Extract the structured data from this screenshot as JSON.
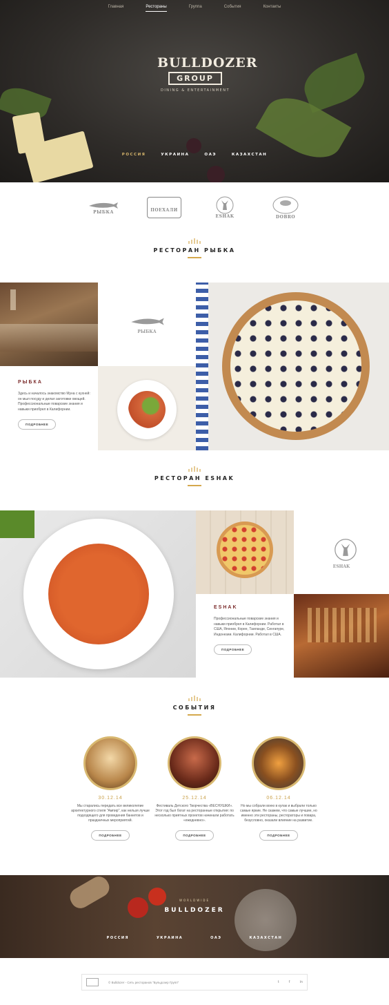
{
  "nav": [
    "Главная",
    "Рестораны",
    "Группа",
    "События",
    "Контакты"
  ],
  "nav_active": 1,
  "logo": {
    "brand": "BULLDOZER",
    "group": "GROUP",
    "tagline": "DINING & ENTERTAINMENT"
  },
  "countries": [
    "РОССИЯ",
    "УКРАИНА",
    "ОАЭ",
    "КАЗАХСТАН"
  ],
  "partners": [
    "РЫБКА",
    "ПОЕХАЛИ",
    "ESHAK",
    "DOBRO"
  ],
  "section1": {
    "title": "РЕСТОРАН РЫБКА"
  },
  "rybka": {
    "heading": "РЫБКА",
    "text": "Здесь и началось знакомство Муна с кухней: он мыл посуду и делал заготовки овощей. Профессиональные поварские знания и навыки приобрел в Калифорнии.",
    "button": "ПОДРОБНЕЕ",
    "logo": "РЫБКА"
  },
  "section2": {
    "title": "РЕСТОРАН ESHAK"
  },
  "eshak": {
    "heading": "ESHAK",
    "text": "Профессиональные поварские знания и навыки приобрел в Калифорнии. Работал в США, Японии, Корее, Таиланде, Сингапуре, Индонезии. Калифорнии. Работал в США.",
    "button": "ПОДРОБНЕЕ",
    "logo": "ESHAK"
  },
  "section3": {
    "title": "СОБЫТИЯ"
  },
  "events": [
    {
      "date": "30.12.14",
      "text": "Мы старались передать все великолепие архитектурного стиля \"Ампир\", как нельзя лучше подходящего для проведения банкетов и праздничных мероприятий.",
      "button": "ПОДРОБНЕЕ"
    },
    {
      "date": "25.12.14",
      "text": "Фестиваль Детского Творчества «ВЕСНУШКИ». Этот год был богат на ресторанные открытия: по несколько приятных проектов начинали работать «ежедневно».",
      "button": "ПОДРОБНЕЕ"
    },
    {
      "date": "06.12.14",
      "text": "Но мы собрали воею в кулак и выбрали только самые яркие. Не скажем, что самые лучшие, но именно эти рестораны, рестораторы и повара, безусловно, оказали влияние на развитие.",
      "button": "ПОДРОБНЕЕ"
    }
  ],
  "banner": {
    "sub": "WORLDWIDE",
    "title": "BULLDOZER",
    "countries": [
      "РОССИЯ",
      "УКРАИНА",
      "ОАЭ",
      "КАЗАХСТАН"
    ]
  },
  "footer": {
    "copy": "© Bulldozer - Сеть ресторанов \"Бульдозер Групп\"",
    "social": [
      "t",
      "f",
      "in"
    ]
  }
}
